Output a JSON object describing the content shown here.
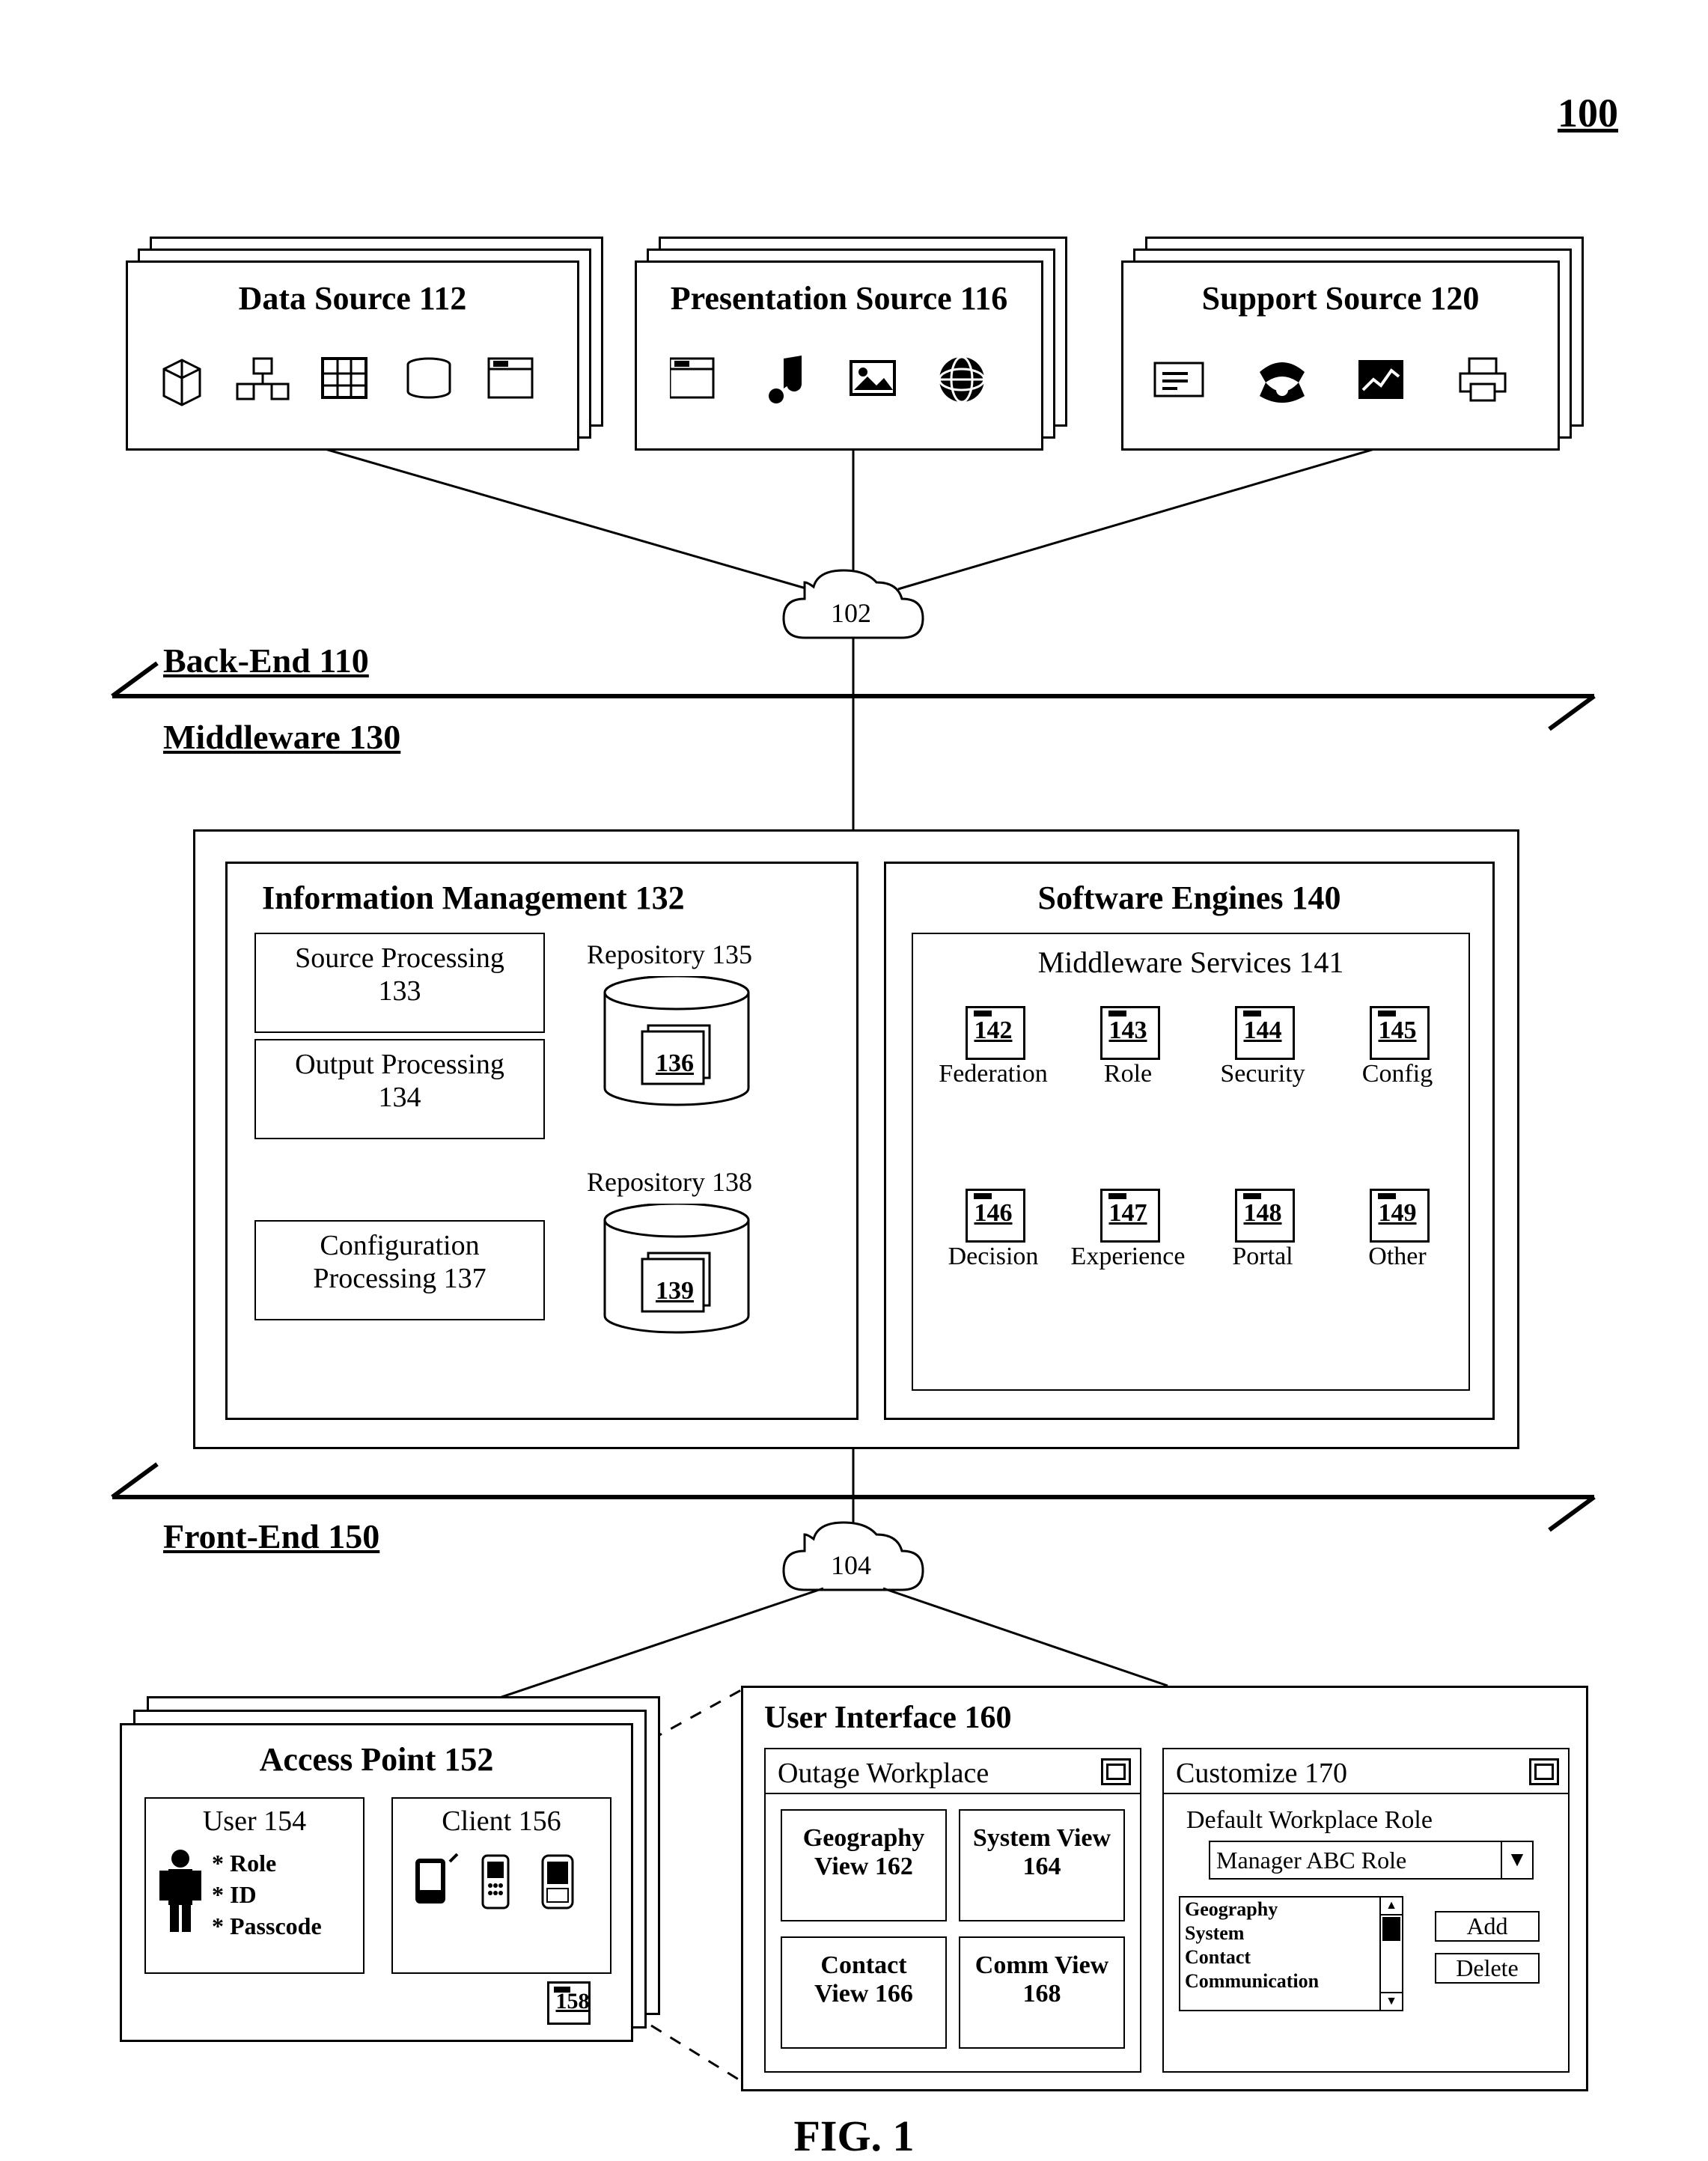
{
  "page_ref": "100",
  "figure": "FIG. 1",
  "sections": {
    "backend": {
      "label": "Back-End 110"
    },
    "middleware": {
      "label": "Middleware 130"
    },
    "frontend": {
      "label": "Front-End 150"
    }
  },
  "clouds": {
    "top": "102",
    "bottom": "104"
  },
  "sources": {
    "data": {
      "title": "Data Source 112"
    },
    "presentation": {
      "title": "Presentation Source 116"
    },
    "support": {
      "title": "Support Source 120"
    }
  },
  "info_mgmt": {
    "title": "Information Management 132",
    "source_proc": {
      "line1": "Source Processing",
      "line2": "133"
    },
    "output_proc": {
      "line1": "Output Processing",
      "line2": "134"
    },
    "config_proc": {
      "line1": "Configuration",
      "line2": "Processing 137"
    },
    "repo1": {
      "label": "Repository 135",
      "inner": "136"
    },
    "repo2": {
      "label": "Repository 138",
      "inner": "139"
    }
  },
  "engines": {
    "title": "Software Engines 140",
    "services_title": "Middleware Services 141",
    "services": [
      {
        "num": "142",
        "label": "Federation"
      },
      {
        "num": "143",
        "label": "Role"
      },
      {
        "num": "144",
        "label": "Security"
      },
      {
        "num": "145",
        "label": "Config"
      },
      {
        "num": "146",
        "label": "Decision"
      },
      {
        "num": "147",
        "label": "Experience"
      },
      {
        "num": "148",
        "label": "Portal"
      },
      {
        "num": "149",
        "label": "Other"
      }
    ]
  },
  "access_point": {
    "title": "Access Point 152",
    "user": {
      "title": "User 154",
      "attrs": {
        "a": "* Role",
        "b": "* ID",
        "c": "* Passcode"
      }
    },
    "client": {
      "title": "Client 156"
    },
    "app_ref": "158"
  },
  "ui": {
    "title": "User Interface 160",
    "workplace": {
      "title": "Outage Workplace",
      "views": {
        "geo": {
          "line1": "Geography",
          "line2": "View 162"
        },
        "system": {
          "line1": "System View",
          "line2": "164"
        },
        "contact": {
          "line1": "Contact",
          "line2": "View 166"
        },
        "comm": {
          "line1": "Comm View",
          "line2": "168"
        }
      }
    },
    "customize": {
      "title": "Customize 170",
      "dd_label": "Default Workplace Role",
      "dd_value": "Manager ABC Role",
      "list": {
        "a": "Geography",
        "b": "System",
        "c": "Contact",
        "d": "Communication"
      },
      "btn_add": "Add",
      "btn_del": "Delete"
    }
  }
}
